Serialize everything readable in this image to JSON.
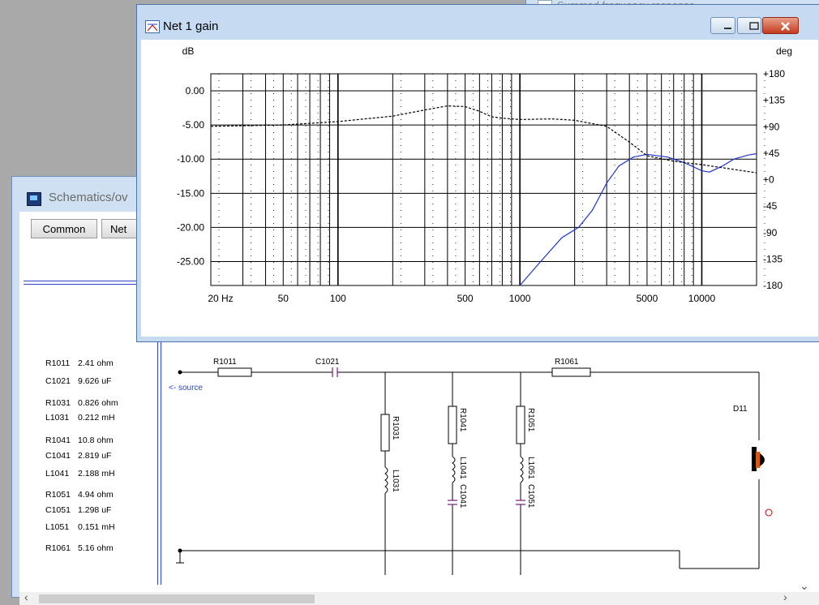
{
  "background_window": {
    "title": "Summed frequency response"
  },
  "schematic_window": {
    "title": "Schematics/ov",
    "tabs": [
      {
        "label": "Common"
      },
      {
        "label": "Net"
      }
    ],
    "parts": [
      {
        "name": "R1011",
        "value": "2.41 ohm"
      },
      {
        "name": "C1021",
        "value": "9.626 uF"
      },
      {
        "name": "R1031",
        "value": "0.826 ohm"
      },
      {
        "name": "L1031",
        "value": "0.212 mH"
      },
      {
        "name": "R1041",
        "value": "10.8 ohm"
      },
      {
        "name": "C1041",
        "value": "2.819 uF"
      },
      {
        "name": "L1041",
        "value": "2.188 mH"
      },
      {
        "name": "R1051",
        "value": "4.94 ohm"
      },
      {
        "name": "C1051",
        "value": "1.298 uF"
      },
      {
        "name": "L1051",
        "value": "0.151 mH"
      },
      {
        "name": "R1061",
        "value": "5.16 ohm"
      }
    ],
    "schematic_labels": {
      "r1011": "R1011",
      "c1021": "C1021",
      "r1061": "R1061",
      "source": "<- source",
      "r1031": "R1031",
      "l1031": "L1031",
      "r1041": "R1041",
      "l1041": "L1041",
      "c1041": "C1041",
      "r1051": "R1051",
      "l1051": "L1051",
      "c1051": "C1051",
      "driver": "D11",
      "plus": "⊕"
    }
  },
  "gain_window": {
    "title": "Net 1 gain"
  },
  "chart_data": {
    "type": "line",
    "title": "",
    "xlabel": "",
    "left_unit": "dB",
    "right_unit": "deg",
    "x_scale": "log",
    "xlim": [
      20,
      20000
    ],
    "ylim_left": [
      -28.5,
      2.5
    ],
    "ylim_right": [
      -180,
      180
    ],
    "grid": true,
    "x_tick_labels": [
      {
        "value": 20,
        "label": "20 Hz"
      },
      {
        "value": 50,
        "label": "50"
      },
      {
        "value": 100,
        "label": "100"
      },
      {
        "value": 500,
        "label": "500"
      },
      {
        "value": 1000,
        "label": "1000"
      },
      {
        "value": 5000,
        "label": "5000"
      },
      {
        "value": 10000,
        "label": "10000"
      }
    ],
    "y_left_ticks": [
      {
        "value": 0,
        "label": "0.00"
      },
      {
        "value": -5,
        "label": "-5.00"
      },
      {
        "value": -10,
        "label": "-10.00"
      },
      {
        "value": -15,
        "label": "-15.00"
      },
      {
        "value": -20,
        "label": "-20.00"
      },
      {
        "value": -25,
        "label": "-25.00"
      }
    ],
    "y_right_ticks": [
      {
        "value": 180,
        "label": "+180"
      },
      {
        "value": 135,
        "label": "+135"
      },
      {
        "value": 90,
        "label": "+90"
      },
      {
        "value": 45,
        "label": "+45"
      },
      {
        "value": 0,
        "label": "+0"
      },
      {
        "value": -45,
        "label": "-45"
      },
      {
        "value": -90,
        "label": "-90"
      },
      {
        "value": -135,
        "label": "-135"
      },
      {
        "value": -180,
        "label": "-180"
      }
    ],
    "series": [
      {
        "axis": "left",
        "style": "solid",
        "color": "#1f35d8",
        "points": [
          [
            1000,
            -28.5
          ],
          [
            1300,
            -25
          ],
          [
            1700,
            -21.5
          ],
          [
            2100,
            -20
          ],
          [
            2500,
            -17.5
          ],
          [
            3000,
            -13.5
          ],
          [
            3500,
            -11
          ],
          [
            4200,
            -9.7
          ],
          [
            5000,
            -9.3
          ],
          [
            6500,
            -9.7
          ],
          [
            8000,
            -10.5
          ],
          [
            10000,
            -11.7
          ],
          [
            11000,
            -11.9
          ],
          [
            13000,
            -11
          ],
          [
            15000,
            -10
          ],
          [
            18000,
            -9.4
          ],
          [
            20000,
            -9.2
          ]
        ]
      },
      {
        "axis": "left",
        "style": "dashed",
        "color": "#000000",
        "points": [
          [
            20,
            -5.2
          ],
          [
            50,
            -5
          ],
          [
            100,
            -4.5
          ],
          [
            200,
            -3.7
          ],
          [
            300,
            -2.8
          ],
          [
            400,
            -2.2
          ],
          [
            500,
            -2.3
          ],
          [
            600,
            -3
          ],
          [
            700,
            -3.8
          ],
          [
            800,
            -4
          ],
          [
            1000,
            -4.2
          ],
          [
            1500,
            -4.1
          ],
          [
            2000,
            -4.3
          ],
          [
            3000,
            -5.2
          ],
          [
            4000,
            -7.5
          ],
          [
            5000,
            -9.5
          ],
          [
            7000,
            -10.3
          ],
          [
            10000,
            -10.8
          ],
          [
            15000,
            -11.5
          ],
          [
            20000,
            -12
          ]
        ]
      }
    ]
  }
}
